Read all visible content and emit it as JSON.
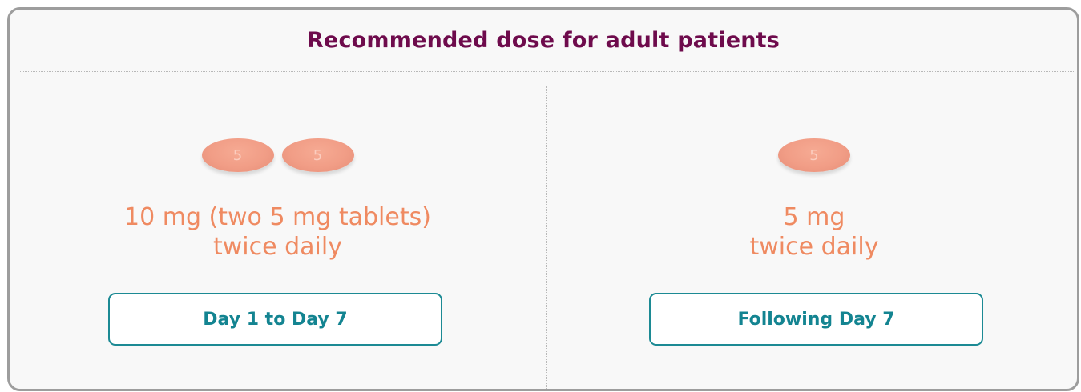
{
  "header": {
    "title": "Recommended dose for adult patients"
  },
  "regimens": [
    {
      "pill_count": 2,
      "pill_marking": "5",
      "dose_line_1": "10 mg (two 5 mg tablets)",
      "dose_line_2": "twice daily",
      "period_label": "Day 1 to Day 7"
    },
    {
      "pill_count": 1,
      "pill_marking": "5",
      "dose_line_1": "5 mg",
      "dose_line_2": "twice daily",
      "period_label": "Following Day 7"
    }
  ],
  "colors": {
    "title": "#6e0b4c",
    "dose_text": "#ef8a61",
    "pill": "#f19d86",
    "button_border": "#1c8a94",
    "button_text": "#138491",
    "card_border": "#9d9d9d",
    "card_background": "#f8f8f8"
  },
  "icons": {
    "tablet": "tablet-icon"
  }
}
